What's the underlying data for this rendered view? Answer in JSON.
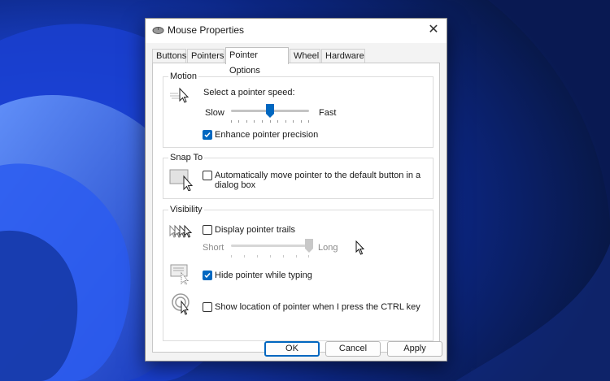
{
  "window": {
    "title": "Mouse Properties",
    "title_icon": "mouse-icon",
    "close_icon": "close-icon",
    "close_glyph": "✕"
  },
  "tabs": [
    {
      "label": "Buttons",
      "active": false
    },
    {
      "label": "Pointers",
      "active": false
    },
    {
      "label": "Pointer Options",
      "active": true
    },
    {
      "label": "Wheel",
      "active": false
    },
    {
      "label": "Hardware",
      "active": false
    }
  ],
  "motion": {
    "group_label": "Motion",
    "icon": "pointer-speed-icon",
    "speed_label": "Select a pointer speed:",
    "slow_label": "Slow",
    "fast_label": "Fast",
    "speed_fraction": 0.5,
    "enhance_label": "Enhance pointer precision",
    "enhance_checked": true
  },
  "snap_to": {
    "group_label": "Snap To",
    "icon": "snap-to-icon",
    "label_line1": "Automatically move pointer to the default button in a",
    "label_line2": "dialog box",
    "checked": false
  },
  "visibility": {
    "group_label": "Visibility",
    "trails_icon": "pointer-trails-icon",
    "trails_label": "Display pointer trails",
    "trails_checked": false,
    "short_label": "Short",
    "long_label": "Long",
    "trails_fraction": 1.0,
    "hide_icon": "hide-pointer-icon",
    "hide_label": "Hide pointer while typing",
    "hide_checked": true,
    "ctrl_icon": "pointer-location-icon",
    "ctrl_label": "Show location of pointer when I press the CTRL key",
    "ctrl_checked": false
  },
  "buttons": {
    "ok": "OK",
    "cancel": "Cancel",
    "apply": "Apply"
  },
  "colors": {
    "accent": "#0067c0",
    "wallpaper": "#0b1f5c"
  }
}
